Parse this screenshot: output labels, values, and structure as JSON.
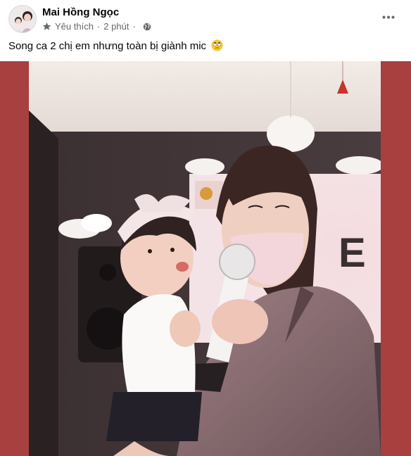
{
  "post": {
    "author": "Mai Hồng Ngọc",
    "reaction_label": "Yêu thích",
    "separator": "·",
    "time": "2 phút",
    "caption": "Song ca 2 chị em nhưng toàn bị giành mic"
  },
  "icons": {
    "favorite": "star-icon",
    "privacy": "globe-icon",
    "menu": "more-options-icon",
    "caption_emoji": "rolling-eyes-emoji"
  },
  "colors": {
    "photo_frame": "#a7403e",
    "secondary_text": "#65676b",
    "primary_text": "#050505"
  }
}
